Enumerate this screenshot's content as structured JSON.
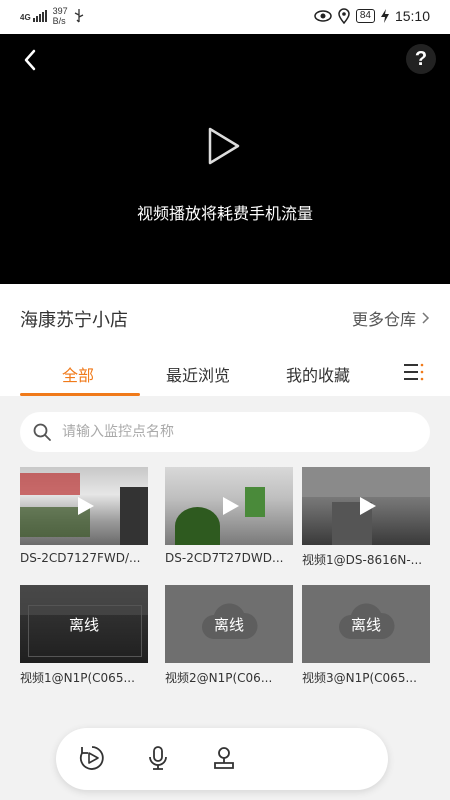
{
  "status_bar": {
    "network": "4G",
    "speed_value": "397",
    "speed_unit": "B/s",
    "battery": "84",
    "time": "15:10",
    "icons": [
      "signal-icon",
      "usb-icon",
      "eye-icon",
      "location-icon",
      "charging-icon"
    ]
  },
  "player": {
    "warning_text": "视频播放将耗费手机流量",
    "icons": [
      "back-icon",
      "help-icon",
      "play-icon"
    ],
    "help_label": "?"
  },
  "store": {
    "name": "海康苏宁小店",
    "more_label": "更多仓库"
  },
  "tabs": [
    {
      "label": "全部",
      "active": true
    },
    {
      "label": "最近浏览",
      "active": false
    },
    {
      "label": "我的收藏",
      "active": false
    }
  ],
  "search": {
    "placeholder": "请输入监控点名称"
  },
  "cameras": [
    {
      "label": "DS-2CD7127FWD/...",
      "online": true
    },
    {
      "label": "DS-2CD7T27DWD...",
      "online": true
    },
    {
      "label": "视频1@DS-8616N-...",
      "online": true
    },
    {
      "label": "视频1@N1P(C065...",
      "online": false,
      "status": "离线"
    },
    {
      "label": "视频2@N1P(C06...",
      "online": false,
      "status": "离线"
    },
    {
      "label": "视频3@N1P(C065...",
      "online": false,
      "status": "离线"
    }
  ],
  "bottom_bar": {
    "icons": [
      "playback-icon",
      "microphone-icon",
      "user-icon"
    ]
  },
  "colors": {
    "accent": "#f07a1a",
    "player_bg": "#000000",
    "offline_tile": "#6f6f6f"
  }
}
